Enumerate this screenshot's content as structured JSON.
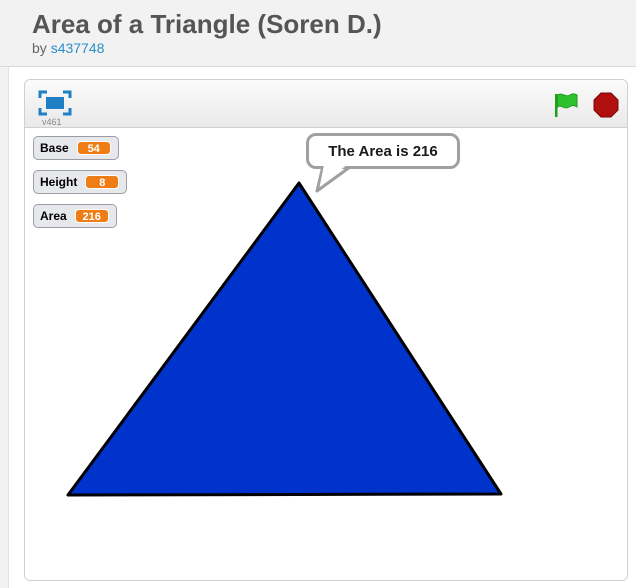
{
  "project": {
    "title": "Area of a Triangle (Soren D.)",
    "by_prefix": "by",
    "author": "s437748"
  },
  "player": {
    "version": "v461",
    "fullscreen_icon": "fullscreen-icon",
    "green_flag_icon": "green-flag-icon",
    "stop_icon": "stop-sign-icon",
    "colors": {
      "accent": "#1f7fc4",
      "flag": "#2ec02e",
      "stop": "#b00f0f"
    }
  },
  "monitors": [
    {
      "label": "Base",
      "value": "54"
    },
    {
      "label": "Height",
      "value": "8"
    },
    {
      "label": "Area",
      "value": "216"
    }
  ],
  "stage": {
    "speech_text": "The Area is 216",
    "sprite": "triangle",
    "sprite_color": "#0033cc"
  }
}
